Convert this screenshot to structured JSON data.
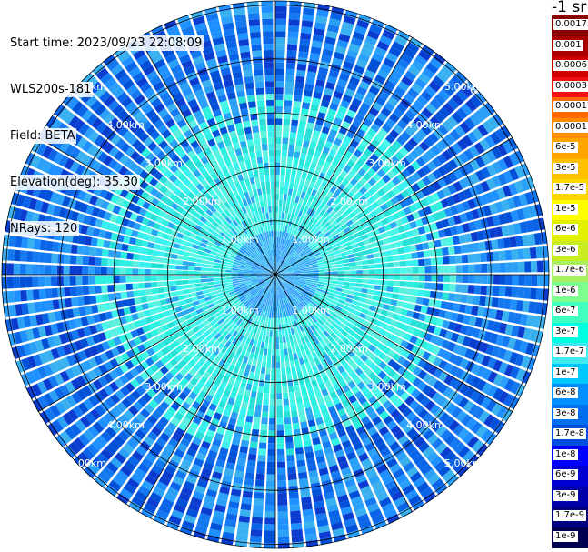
{
  "info": {
    "start_time": "Start time: 2023/09/23 22:08:09",
    "instrument": "WLS200s-181",
    "field": "Field: BETA",
    "elevation": "Elevation(deg): 35.30",
    "nrays": "NRays: 120"
  },
  "range_rings": {
    "labels": [
      "1.00km",
      "2.00km",
      "3.00km",
      "4.00km",
      "5.00km",
      "6.00km"
    ]
  },
  "colorbar": {
    "unit_label": "-1 sr",
    "labels": [
      "0.0017",
      "0.001",
      "0.0006",
      "0.0003",
      "0.00017",
      "0.0001",
      "6e-5",
      "3e-5",
      "1.7e-5",
      "1e-5",
      "6e-6",
      "3e-6",
      "1.7e-6",
      "1e-6",
      "6e-7",
      "3e-7",
      "1.7e-7",
      "1e-7",
      "6e-8",
      "3e-8",
      "1.7e-8",
      "1e-8",
      "6e-9",
      "3e-9",
      "1.7e-9",
      "1e-9"
    ],
    "colors": [
      "#8b0000",
      "#a80000",
      "#d00000",
      "#f01010",
      "#ff6a00",
      "#ff8c00",
      "#ffa500",
      "#ffc000",
      "#ffd700",
      "#ffff00",
      "#e0f000",
      "#c8ec20",
      "#a8f060",
      "#7fff90",
      "#40ffc0",
      "#00ffe0",
      "#40e8f0",
      "#00c8ff",
      "#0090ff",
      "#0070f0",
      "#0050e0",
      "#0000ff",
      "#0000d0",
      "#0000a8",
      "#000080",
      "#000050"
    ]
  }
}
